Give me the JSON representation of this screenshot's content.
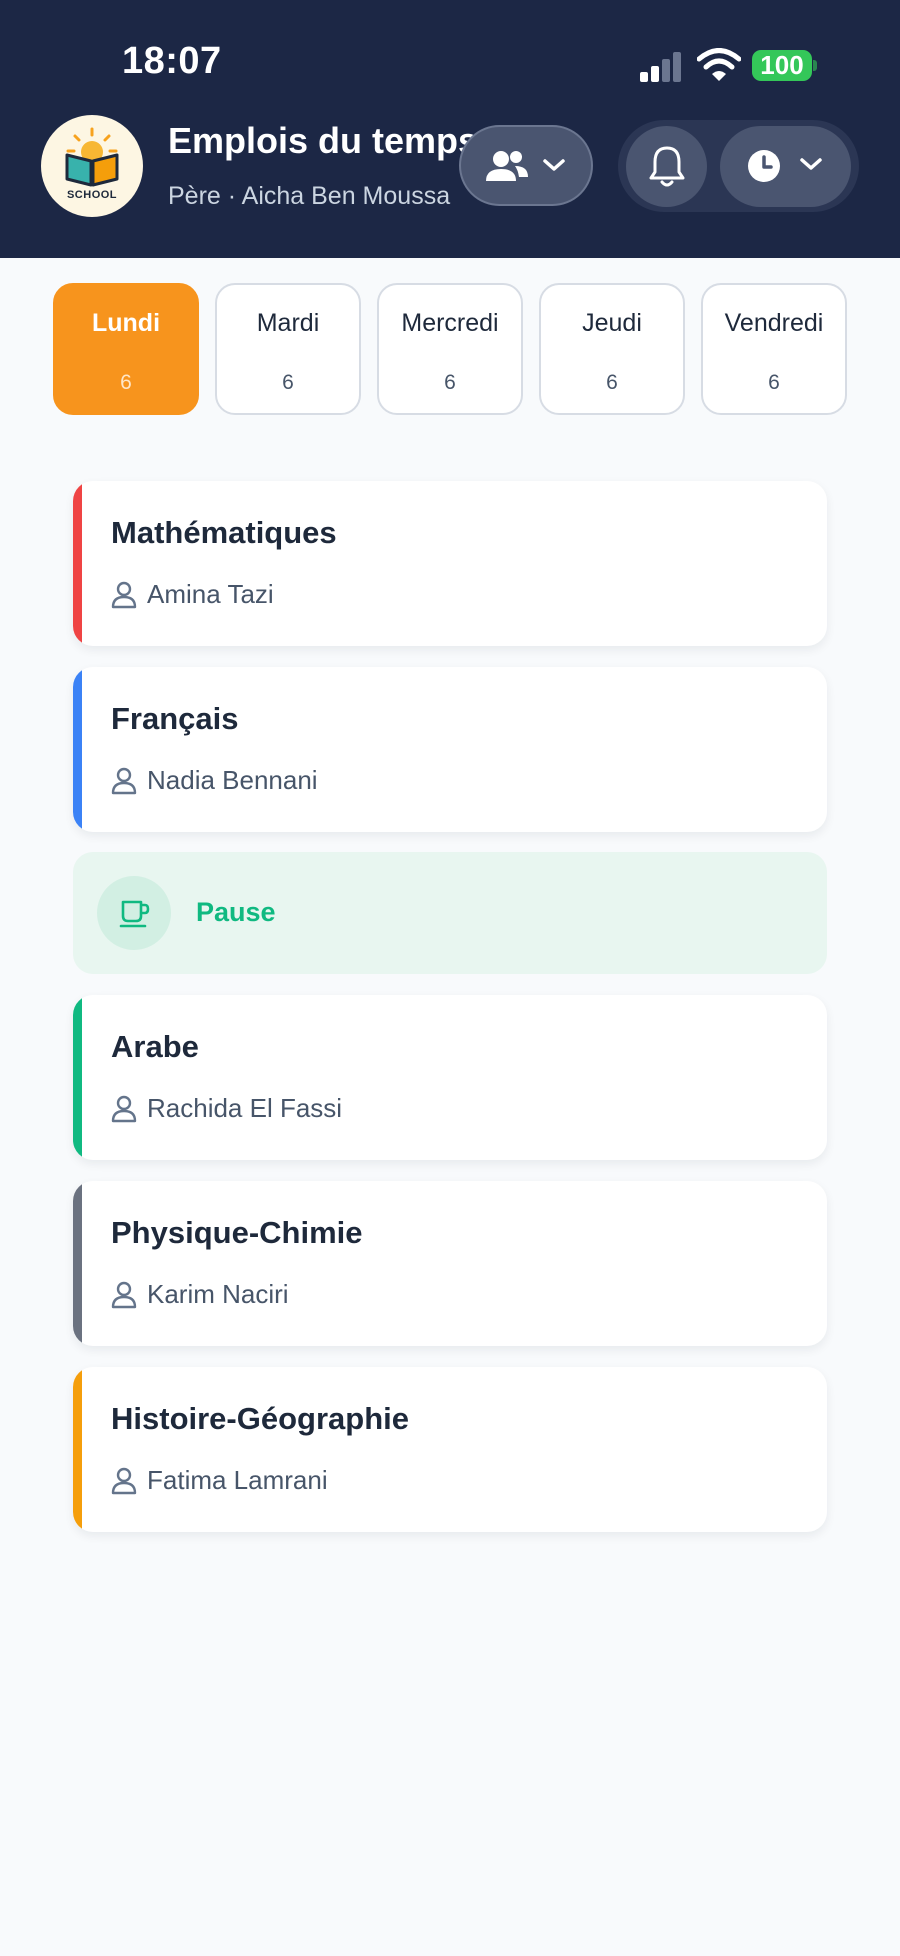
{
  "status_bar": {
    "time": "18:07",
    "battery": "100"
  },
  "header": {
    "logo_text": "SCHOOL",
    "title": "Emplois du temps",
    "subtitle": "Père · Aicha Ben Moussa",
    "icons": {
      "child_selector": "people-icon",
      "notifications": "bell-icon",
      "period_selector": "clock-icon"
    }
  },
  "days": [
    {
      "name": "Lundi",
      "count": "6",
      "active": true
    },
    {
      "name": "Mardi",
      "count": "6",
      "active": false
    },
    {
      "name": "Mercredi",
      "count": "6",
      "active": false
    },
    {
      "name": "Jeudi",
      "count": "6",
      "active": false
    },
    {
      "name": "Vendredi",
      "count": "6",
      "active": false
    }
  ],
  "lessons": [
    {
      "subject": "Mathématiques",
      "teacher": "Amina Tazi",
      "color": "#ef4444"
    },
    {
      "subject": "Français",
      "teacher": "Nadia Bennani",
      "color": "#3b82f6"
    },
    {
      "subject": "Arabe",
      "teacher": "Rachida El Fassi",
      "color": "#10b981"
    },
    {
      "subject": "Physique-Chimie",
      "teacher": "Karim Naciri",
      "color": "#6b7280"
    },
    {
      "subject": "Histoire-Géographie",
      "teacher": "Fatima Lamrani",
      "color": "#f59e0b"
    }
  ],
  "break": {
    "label": "Pause",
    "icon": "coffee-cup-icon",
    "color": "#10b981"
  },
  "colors": {
    "header_bg": "#1c2745",
    "active_day": "#f7941d",
    "battery": "#34c759"
  }
}
